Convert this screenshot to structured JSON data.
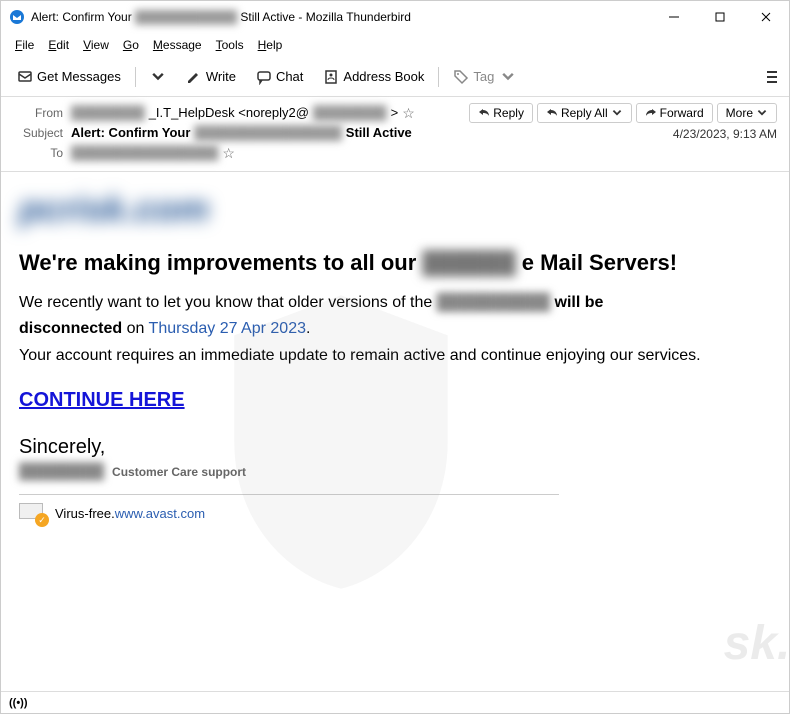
{
  "titlebar": {
    "text_prefix": "Alert: Confirm Your ",
    "text_blur": "████████████",
    "text_suffix": " Still Active - Mozilla Thunderbird"
  },
  "menubar": {
    "file": "File",
    "edit": "Edit",
    "view": "View",
    "go": "Go",
    "message": "Message",
    "tools": "Tools",
    "help": "Help"
  },
  "toolbar": {
    "get_messages": "Get Messages",
    "write": "Write",
    "chat": "Chat",
    "address_book": "Address Book",
    "tag": "Tag"
  },
  "header": {
    "from_label": "From",
    "from_blur1": "████████",
    "from_text": "_I.T_HelpDesk <noreply2@",
    "from_blur2": "████████",
    "from_close": ">",
    "subject_label": "Subject",
    "subject_prefix": "Alert: Confirm Your ",
    "subject_blur": "████████████████",
    "subject_suffix": " Still Active",
    "to_label": "To",
    "to_blur": "████████████████",
    "date": "4/23/2023, 9:13 AM"
  },
  "actions": {
    "reply": "Reply",
    "reply_all": "Reply All",
    "forward": "Forward",
    "more": "More"
  },
  "body": {
    "logo_blur": "pcrisk.com",
    "heading_prefix": "We're making improvements to all our ",
    "heading_blur": "██████",
    "heading_suffix": " e Mail Servers!",
    "para1_prefix": "We recently want to let you know that older versions of the ",
    "para1_blur": "██████████",
    "para1_mid": " will be",
    "para1_bold": "disconnected",
    "para1_on": "  on  ",
    "para1_date": "Thursday 27 Apr 2023",
    "para1_dot": ".",
    "para2": "Your account requires an immediate update to remain active and continue enjoying our services.",
    "continue": "CONTINUE HERE",
    "sincerely": "Sincerely,",
    "sig_blur": "████████",
    "sig_text": "Customer Care support",
    "virus_text": "Virus-free.",
    "virus_link": "www.avast.com"
  },
  "statusbar": {
    "icon": "(•)"
  }
}
